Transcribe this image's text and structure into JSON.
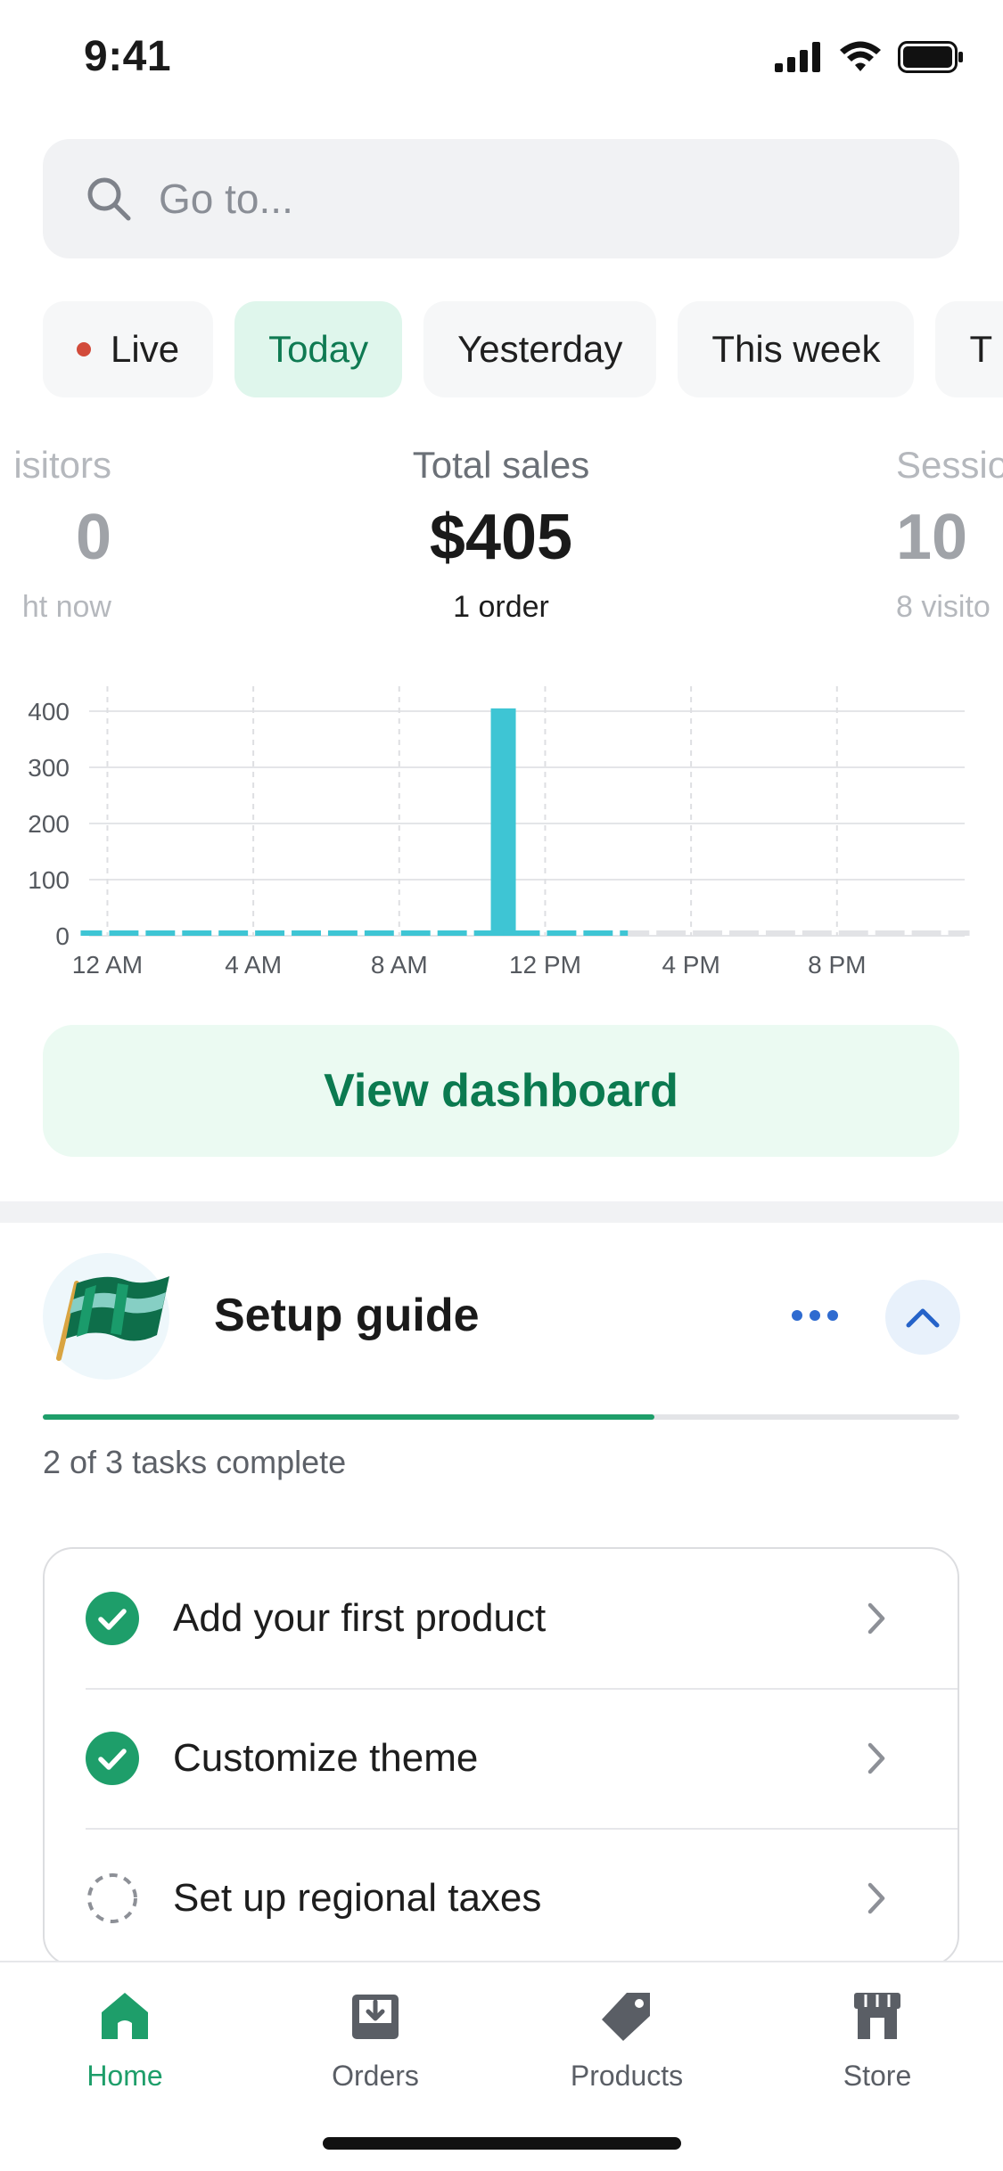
{
  "status_bar": {
    "time": "9:41"
  },
  "search": {
    "placeholder": "Go to..."
  },
  "chips": [
    {
      "label": "Live",
      "has_dot": true
    },
    {
      "label": "Today",
      "active": true
    },
    {
      "label": "Yesterday"
    },
    {
      "label": "This week"
    },
    {
      "label": "T"
    }
  ],
  "metrics": {
    "left": {
      "label": "isitors",
      "value": "0",
      "sub": "ht now"
    },
    "center": {
      "label": "Total sales",
      "value": "$405",
      "sub": "1 order"
    },
    "right": {
      "label": "Sessio",
      "value": "10",
      "sub": "8 visito"
    }
  },
  "chart_data": {
    "type": "bar",
    "categories": [
      "12 AM",
      "1 AM",
      "2 AM",
      "3 AM",
      "4 AM",
      "5 AM",
      "6 AM",
      "7 AM",
      "8 AM",
      "9 AM",
      "10 AM",
      "11 AM",
      "12 PM",
      "1 PM",
      "2 PM",
      "3 PM",
      "4 PM",
      "5 PM",
      "6 PM",
      "7 PM",
      "8 PM",
      "9 PM",
      "10 PM",
      "11 PM"
    ],
    "values": [
      0,
      0,
      0,
      0,
      0,
      0,
      0,
      0,
      0,
      0,
      0,
      405,
      0,
      0,
      0,
      0,
      0,
      0,
      0,
      0,
      0,
      0,
      0,
      0
    ],
    "active_hours": 15,
    "x_tick_labels": [
      "12 AM",
      "4 AM",
      "8 AM",
      "12 PM",
      "4 PM",
      "8 PM"
    ],
    "y_tick_labels": [
      "400",
      "300",
      "200",
      "100",
      "0"
    ],
    "ylim": [
      0,
      400
    ],
    "bar_color": "#3ec5d4",
    "future_color": "#e2e3e6",
    "grid": true
  },
  "dashboard_button": {
    "label": "View dashboard"
  },
  "setup_guide": {
    "title": "Setup guide",
    "progress": 0.667,
    "progress_text": "2 of 3 tasks complete",
    "tasks": [
      {
        "label": "Add your first product",
        "done": true
      },
      {
        "label": "Customize theme",
        "done": true
      },
      {
        "label": "Set up regional taxes",
        "done": false
      }
    ]
  },
  "tabbar": [
    {
      "label": "Home",
      "icon": "home-icon",
      "active": true
    },
    {
      "label": "Orders",
      "icon": "orders-icon"
    },
    {
      "label": "Products",
      "icon": "tag-icon"
    },
    {
      "label": "Store",
      "icon": "store-icon"
    }
  ],
  "colors": {
    "accent": "#1e9e6a",
    "chip_active_bg": "#dff6ec",
    "live_dot": "#d24b3b"
  }
}
